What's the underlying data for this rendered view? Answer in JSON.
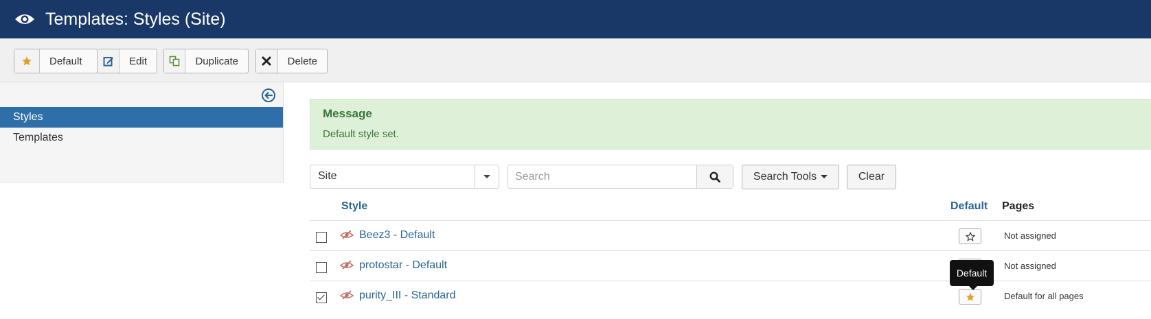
{
  "header": {
    "title": "Templates: Styles (Site)",
    "icon": "eye-icon"
  },
  "toolbar": {
    "default_label": "Default",
    "edit_label": "Edit",
    "duplicate_label": "Duplicate",
    "delete_label": "Delete"
  },
  "sidebar": {
    "items": [
      {
        "label": "Styles",
        "active": true
      },
      {
        "label": "Templates",
        "active": false
      }
    ]
  },
  "message": {
    "heading": "Message",
    "body": "Default style set."
  },
  "filters": {
    "client_select": "Site",
    "search_placeholder": "Search",
    "search_tools_label": "Search Tools",
    "clear_label": "Clear"
  },
  "table": {
    "columns": {
      "style": "Style",
      "default": "Default",
      "pages": "Pages"
    },
    "rows": [
      {
        "name": "Beez3 - Default",
        "checked": false,
        "is_default": false,
        "pages": "Not assigned"
      },
      {
        "name": "protostar - Default",
        "checked": false,
        "is_default": false,
        "pages": "Not assigned"
      },
      {
        "name": "purity_III - Standard",
        "checked": true,
        "is_default": true,
        "pages": "Default for all pages"
      }
    ]
  },
  "tooltip": {
    "text": "Default"
  },
  "colors": {
    "header_bg": "#1a3867",
    "sidebar_active": "#2f6fa9",
    "link": "#2a6496",
    "message_bg": "#dff0d8",
    "message_text": "#3c763d",
    "star_gold": "#e59e2d"
  }
}
